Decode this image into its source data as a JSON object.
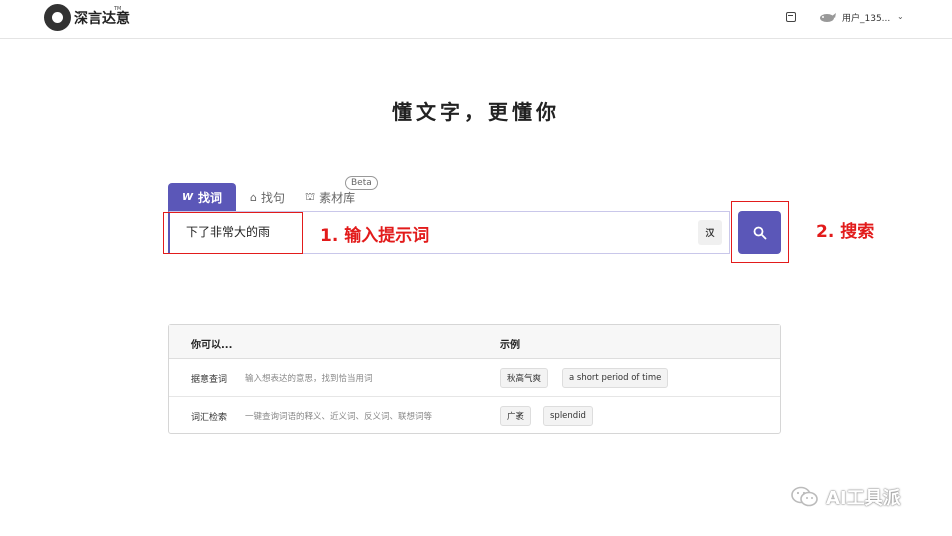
{
  "header": {
    "logo_text": "深言达意",
    "logo_tm": "TM",
    "username": "用户_135...",
    "calendar_icon": "calendar-icon",
    "avatar_icon": "whale-avatar-icon",
    "dropdown_icon": "chevron-down-icon"
  },
  "hero": {
    "slogan": "懂文字，更懂你"
  },
  "tabs": [
    {
      "icon": "W",
      "label": "找词"
    },
    {
      "icon": "⌂",
      "label": "找句"
    },
    {
      "icon": "⛫",
      "label": "素材库",
      "badge": "Beta"
    }
  ],
  "search": {
    "value": "下了非常大的雨",
    "translate_label": "汉",
    "search_icon": "search-icon"
  },
  "annotations": {
    "step1": "1. 输入提示词",
    "step2": "2. 搜索"
  },
  "table": {
    "col1": "你可以...",
    "col2": "示例",
    "rows": [
      {
        "name": "据意查词",
        "desc": "输入想表达的意思，找到恰当用词",
        "examples": [
          "秋高气爽",
          "a short period of time"
        ]
      },
      {
        "name": "词汇检索",
        "desc": "一键查询词语的释义、近义词、反义词、联想词等",
        "examples": [
          "广袤",
          "splendid"
        ]
      }
    ]
  },
  "watermark": {
    "text": "AI工具派"
  },
  "colors": {
    "accent": "#5b57b8",
    "annotation": "#e21b1b"
  }
}
